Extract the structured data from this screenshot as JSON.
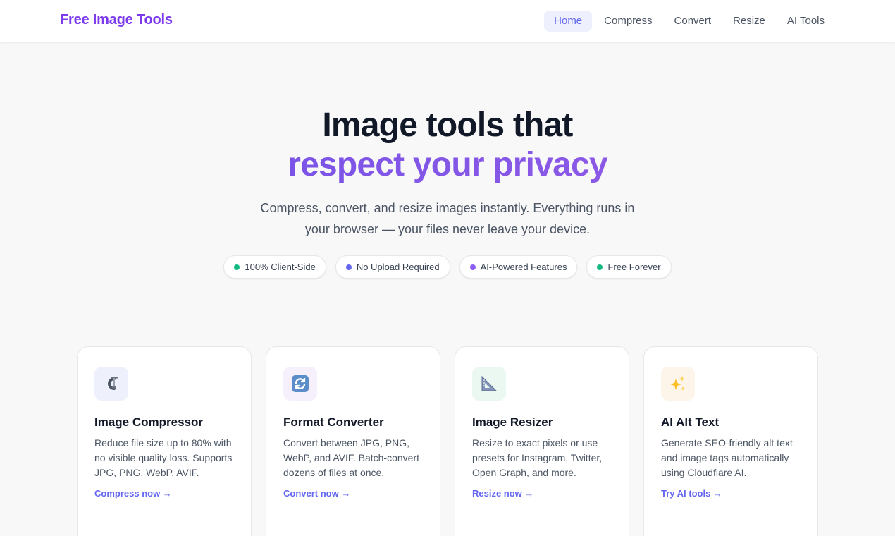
{
  "nav": {
    "brand": "Free Image Tools",
    "links": [
      {
        "label": "Home",
        "active": true
      },
      {
        "label": "Compress",
        "active": false
      },
      {
        "label": "Convert",
        "active": false
      },
      {
        "label": "Resize",
        "active": false
      },
      {
        "label": "AI Tools",
        "active": false
      }
    ]
  },
  "hero": {
    "title_line1": "Image tools that",
    "title_line2": "respect your privacy",
    "subtitle": "Compress, convert, and resize images instantly. Everything runs in your browser — your files never leave your device."
  },
  "badges": [
    {
      "label": "100% Client-Side",
      "dot_color": "#10b981"
    },
    {
      "label": "No Upload Required",
      "dot_color": "#6366f1"
    },
    {
      "label": "AI-Powered Features",
      "dot_color": "#8b5cf6"
    },
    {
      "label": "Free Forever",
      "dot_color": "#10b981"
    }
  ],
  "cards": [
    {
      "icon": "clamp-icon",
      "icon_bg": "#eef1fb",
      "title": "Image Compressor",
      "description": "Reduce file size up to 80% with no visible quality loss. Supports JPG, PNG, WebP, AVIF.",
      "link": "Compress now →"
    },
    {
      "icon": "refresh-arrows-icon",
      "icon_bg": "#f6f0fd",
      "title": "Format Converter",
      "description": "Convert between JPG, PNG, WebP, and AVIF. Batch-convert dozens of files at once.",
      "link": "Convert now →"
    },
    {
      "icon": "triangular-ruler-icon",
      "icon_bg": "#ebf8f1",
      "title": "Image Resizer",
      "description": "Resize to exact pixels or use presets for Instagram, Twitter, Open Graph, and more.",
      "link": "Resize now →"
    },
    {
      "icon": "sparkles-icon",
      "icon_bg": "#fdf4ea",
      "title": "AI Alt Text",
      "description": "Generate SEO-friendly alt text and image tags automatically using Cloudflare AI.",
      "link": "Try AI tools →"
    }
  ],
  "colors": {
    "accent": "#6366f1",
    "brand": "#7c3aed"
  }
}
